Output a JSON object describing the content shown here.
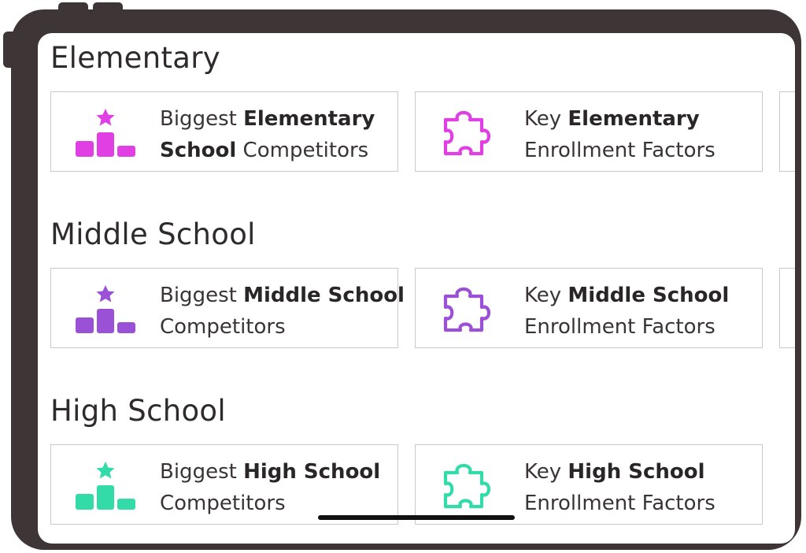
{
  "colors": {
    "elementary": "#e03fe3",
    "middle": "#9b51d6",
    "high": "#33dba9"
  },
  "sections": [
    {
      "title": "Elementary",
      "competitors": {
        "l1_pre": "Biggest ",
        "l1_bold": "Elementary",
        "l2_bold": "School",
        "l2_post": " Competitors"
      },
      "factors": {
        "l1_pre": "Key ",
        "l1_bold": "Elementary",
        "l2_post": "Enrollment Factors"
      }
    },
    {
      "title": "Middle School",
      "competitors": {
        "l1_pre": "Biggest ",
        "l1_bold": "Middle School",
        "l2_post": "Competitors"
      },
      "factors": {
        "l1_pre": "Key ",
        "l1_bold": "Middle School",
        "l2_post": "Enrollment Factors"
      }
    },
    {
      "title": "High School",
      "competitors": {
        "l1_pre": "Biggest ",
        "l1_bold": "High School",
        "l2_post": "Competitors"
      },
      "factors": {
        "l1_pre": "Key ",
        "l1_bold": "High School",
        "l2_post": "Enrollment Factors"
      }
    }
  ],
  "icons": {
    "competitors": "podium-star-icon",
    "factors": "puzzle-piece-icon"
  }
}
